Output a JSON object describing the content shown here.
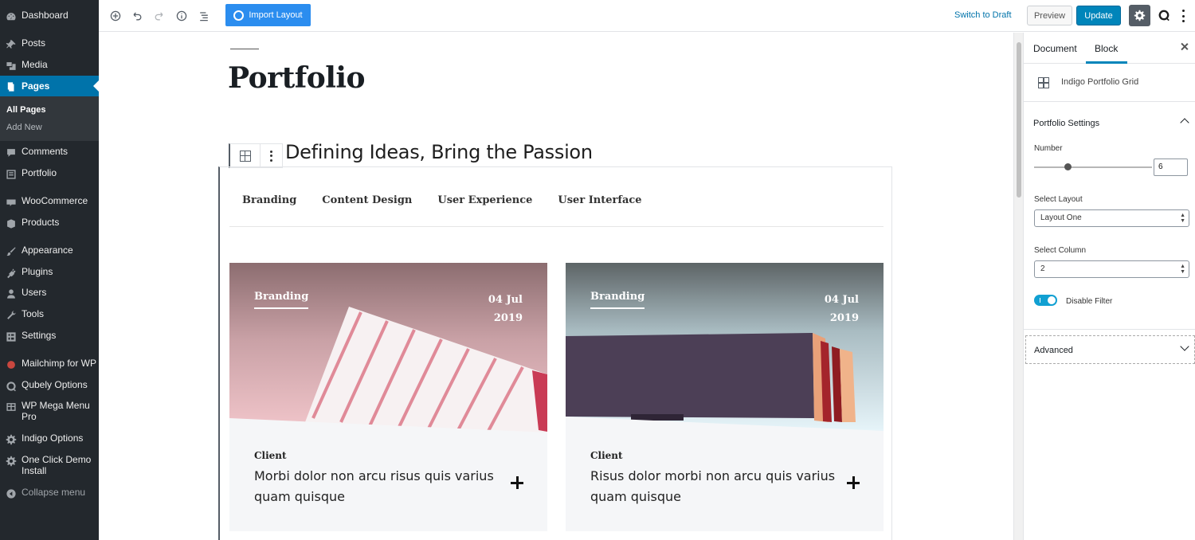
{
  "admin_menu": {
    "items": [
      {
        "label": "Dashboard",
        "icon": "dashboard-icon"
      },
      {
        "label": "Posts",
        "icon": "pin-icon"
      },
      {
        "label": "Media",
        "icon": "media-icon"
      },
      {
        "label": "Pages",
        "icon": "pages-icon"
      },
      {
        "label": "Comments",
        "icon": "comment-icon"
      },
      {
        "label": "Portfolio",
        "icon": "portfolio-icon"
      },
      {
        "label": "WooCommerce",
        "icon": "woocommerce-icon"
      },
      {
        "label": "Products",
        "icon": "products-icon"
      },
      {
        "label": "Appearance",
        "icon": "brush-icon"
      },
      {
        "label": "Plugins",
        "icon": "plug-icon"
      },
      {
        "label": "Users",
        "icon": "user-icon"
      },
      {
        "label": "Tools",
        "icon": "wrench-icon"
      },
      {
        "label": "Settings",
        "icon": "settings-icon"
      },
      {
        "label": "Mailchimp for WP",
        "icon": "mailchimp-icon"
      },
      {
        "label": "Qubely Options",
        "icon": "qubely-icon"
      },
      {
        "label": "WP Mega Menu Pro",
        "icon": "megamenu-icon"
      },
      {
        "label": "Indigo Options",
        "icon": "gear-icon"
      },
      {
        "label": "One Click Demo Install",
        "icon": "gear-icon"
      },
      {
        "label": "Collapse menu",
        "icon": "collapse-icon"
      }
    ],
    "submenu": [
      "All Pages",
      "Add New"
    ]
  },
  "toolbar": {
    "import_label": "Import Layout",
    "switch_draft": "Switch to Draft",
    "preview": "Preview",
    "update": "Update"
  },
  "editor": {
    "page_title": "Portfolio",
    "heading": "Defining Ideas, Bring the Passion",
    "filters": [
      "Branding",
      "Content Design",
      "User Experience",
      "User Interface"
    ],
    "cards": [
      {
        "category": "Branding",
        "date_day": "04 Jul",
        "date_year": "2019",
        "client_label": "Client",
        "description": "Morbi dolor non arcu risus quis varius quam quisque"
      },
      {
        "category": "Branding",
        "date_day": "04 Jul",
        "date_year": "2019",
        "client_label": "Client",
        "description": "Risus dolor morbi non arcu quis varius quam quisque"
      }
    ]
  },
  "sidebar": {
    "tabs": [
      "Document",
      "Block"
    ],
    "active_tab": "Block",
    "block_name": "Indigo Portfolio Grid",
    "panel_title": "Portfolio Settings",
    "number_label": "Number",
    "number_value": "6",
    "layout_label": "Select Layout",
    "layout_value": "Layout One",
    "column_label": "Select Column",
    "column_value": "2",
    "disable_filter_label": "Disable Filter",
    "disable_filter_on": true,
    "advanced_label": "Advanced"
  },
  "colors": {
    "admin_bg": "#23282d",
    "admin_current": "#0073aa",
    "primary_button": "#0085ba",
    "import_button": "#2b8def",
    "toggle_on": "#11a0d2"
  }
}
